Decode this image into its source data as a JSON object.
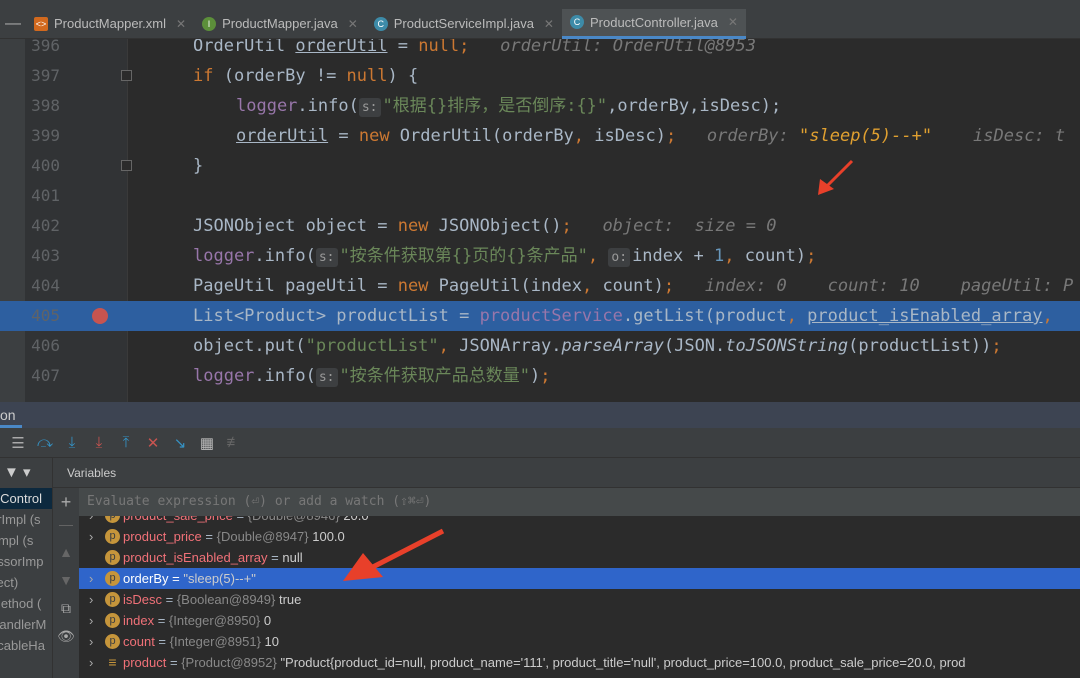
{
  "tabs": [
    {
      "label": "ProductMapper.xml",
      "icon": "xml-file-icon",
      "color": "#d2691e",
      "glyph": "<>"
    },
    {
      "label": "ProductMapper.java",
      "icon": "interface-icon",
      "color": "#5c8f3a",
      "glyph": "I"
    },
    {
      "label": "ProductServiceImpl.java",
      "icon": "class-icon",
      "color": "#3d8ba8",
      "glyph": "C"
    },
    {
      "label": "ProductController.java",
      "icon": "class-icon",
      "color": "#3d8ba8",
      "glyph": "C",
      "active": true
    }
  ],
  "code": [
    {
      "n": "396",
      "i": 2,
      "t": [
        [
          "OrderUtil ",
          ""
        ],
        [
          "orderUtil",
          "ul"
        ],
        [
          " = ",
          ""
        ],
        [
          "null",
          "kw"
        ],
        [
          ";",
          "kw"
        ],
        [
          "   orderUtil: OrderUtil@8953",
          "hint"
        ]
      ]
    },
    {
      "n": "397",
      "i": 2,
      "fold": true,
      "t": [
        [
          "if ",
          "kw"
        ],
        [
          "(orderBy != ",
          ""
        ],
        [
          "null",
          "kw"
        ],
        [
          ") {",
          ""
        ]
      ]
    },
    {
      "n": "398",
      "i": 3,
      "t": [
        [
          "logger",
          "fld"
        ],
        [
          ".info(",
          ""
        ],
        [
          "s:",
          "badge"
        ],
        [
          "\"根据{}排序，是否倒序:{}\"",
          "str"
        ],
        [
          ",",
          ""
        ],
        [
          "orderBy",
          ""
        ],
        [
          ",",
          ""
        ],
        [
          "isDesc);",
          ""
        ]
      ]
    },
    {
      "n": "399",
      "i": 3,
      "t": [
        [
          "orderUtil",
          "ul"
        ],
        [
          " = ",
          ""
        ],
        [
          "new ",
          "kw"
        ],
        [
          "OrderUtil(orderBy",
          ""
        ],
        [
          ", ",
          "kw"
        ],
        [
          "isDesc)",
          ""
        ],
        [
          ";",
          "kw"
        ],
        [
          "   orderBy: ",
          "hint"
        ],
        [
          "\"sleep(5)--+\"",
          "hintv"
        ],
        [
          "    isDesc: t",
          "hint"
        ]
      ]
    },
    {
      "n": "400",
      "i": 2,
      "fold": true,
      "t": [
        [
          "}",
          ""
        ]
      ]
    },
    {
      "n": "401",
      "i": 2,
      "t": []
    },
    {
      "n": "402",
      "i": 2,
      "t": [
        [
          "JSONObject object = ",
          ""
        ],
        [
          "new ",
          "kw"
        ],
        [
          "JSONObject()",
          ""
        ],
        [
          ";",
          "kw"
        ],
        [
          "   object:  size = 0",
          "hint"
        ]
      ]
    },
    {
      "n": "403",
      "i": 2,
      "t": [
        [
          "logger",
          "fld"
        ],
        [
          ".info(",
          ""
        ],
        [
          "s:",
          "badge"
        ],
        [
          "\"按条件获取第{}页的{}条产品\"",
          "str"
        ],
        [
          ", ",
          "kw"
        ],
        [
          "o:",
          "badge"
        ],
        [
          "index + ",
          ""
        ],
        [
          "1",
          "num"
        ],
        [
          ", ",
          "kw"
        ],
        [
          "count)",
          ""
        ],
        [
          ";",
          "kw"
        ]
      ]
    },
    {
      "n": "404",
      "i": 2,
      "t": [
        [
          "PageUtil pageUtil = ",
          ""
        ],
        [
          "new ",
          "kw"
        ],
        [
          "PageUtil(index",
          ""
        ],
        [
          ", ",
          "kw"
        ],
        [
          "count)",
          ""
        ],
        [
          ";",
          "kw"
        ],
        [
          "   index: 0    count: 10    pageUtil: P",
          "hint"
        ]
      ]
    },
    {
      "n": "405",
      "i": 2,
      "hl": true,
      "bp": true,
      "t": [
        [
          "List<Product> productList = ",
          ""
        ],
        [
          "productService",
          "fld"
        ],
        [
          ".getList(product",
          ""
        ],
        [
          ", ",
          "kw"
        ],
        [
          "product_isEnabled_array",
          "ul"
        ],
        [
          ",",
          "kw"
        ]
      ]
    },
    {
      "n": "406",
      "i": 2,
      "t": [
        [
          "object.put(",
          ""
        ],
        [
          "\"productList\"",
          "str"
        ],
        [
          ", ",
          "kw"
        ],
        [
          "JSONArray.",
          ""
        ],
        [
          "parseArray",
          "it"
        ],
        [
          "(JSON.",
          ""
        ],
        [
          "toJSONString",
          "it"
        ],
        [
          "(productList))",
          ""
        ],
        [
          ";",
          "kw"
        ]
      ]
    },
    {
      "n": "407",
      "i": 2,
      "t": [
        [
          "logger",
          "fld"
        ],
        [
          ".info(",
          ""
        ],
        [
          "s:",
          "badge"
        ],
        [
          "\"按条件获取产品总数量\"",
          "str"
        ],
        [
          ")",
          ""
        ],
        [
          ";",
          "kw"
        ]
      ]
    }
  ],
  "panel": {
    "tab_label": "on",
    "variables_label": "Variables",
    "eval_placeholder": "Evaluate expression (⏎) or add a watch (⇧⌘⏎)",
    "frames": [
      "",
      "ctControl",
      "orImpl (s",
      "rImpl (s",
      "essorImp",
      "flect)",
      "Method (",
      "HandlerM",
      "ocableHa"
    ],
    "variables": [
      {
        "name": "product_sale_price",
        "type": "{Double@8946}",
        "value": "20.0",
        "exp": true
      },
      {
        "name": "product_price",
        "type": "{Double@8947}",
        "value": "100.0",
        "exp": true
      },
      {
        "name": "product_isEnabled_array",
        "type": "",
        "value": "null",
        "exp": false
      },
      {
        "name": "orderBy",
        "type": "",
        "value": "\"sleep(5)--+\"",
        "exp": true,
        "sel": true
      },
      {
        "name": "isDesc",
        "type": "{Boolean@8949}",
        "value": "true",
        "exp": true
      },
      {
        "name": "index",
        "type": "{Integer@8950}",
        "value": "0",
        "exp": true
      },
      {
        "name": "count",
        "type": "{Integer@8951}",
        "value": "10",
        "exp": true
      },
      {
        "name": "product",
        "type": "{Product@8952}",
        "value": "\"Product{product_id=null, product_name='111', product_title='null', product_price=100.0, product_sale_price=20.0, prod",
        "exp": true,
        "obj": true
      }
    ]
  },
  "colors": {
    "accent": "#2f65ca",
    "annotation_arrow": "#e8402a",
    "execution_line": "#2d5fa0"
  }
}
